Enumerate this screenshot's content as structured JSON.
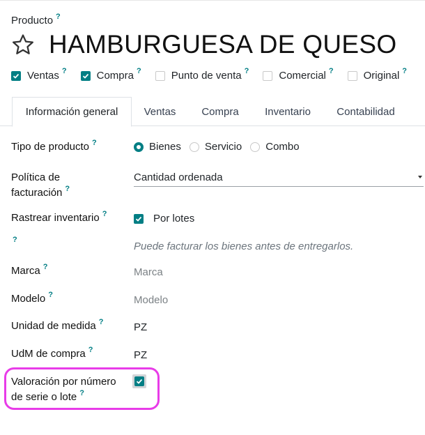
{
  "header": {
    "product_label": "Producto",
    "help_mark": "?",
    "title": "HAMBURGUESA DE QUESO"
  },
  "flags": [
    {
      "label": "Ventas",
      "checked": true
    },
    {
      "label": "Compra",
      "checked": true
    },
    {
      "label": "Punto de venta",
      "checked": false
    },
    {
      "label": "Comercial",
      "checked": false
    },
    {
      "label": "Original",
      "checked": false
    }
  ],
  "tabs": [
    {
      "label": "Información general",
      "active": true
    },
    {
      "label": "Ventas",
      "active": false
    },
    {
      "label": "Compra",
      "active": false
    },
    {
      "label": "Inventario",
      "active": false
    },
    {
      "label": "Contabilidad",
      "active": false
    }
  ],
  "form": {
    "product_type": {
      "label": "Tipo de producto",
      "options": [
        {
          "label": "Bienes",
          "selected": true
        },
        {
          "label": "Servicio",
          "selected": false
        },
        {
          "label": "Combo",
          "selected": false
        }
      ]
    },
    "invoicing_policy": {
      "label_line1": "Política de",
      "label_line2": "facturación",
      "value": "Cantidad ordenada"
    },
    "track_inventory": {
      "label": "Rastrear inventario",
      "checked": true,
      "option_label": "Por lotes"
    },
    "note": "Puede facturar los bienes antes de entregarlos.",
    "brand": {
      "label": "Marca",
      "placeholder": "Marca"
    },
    "model": {
      "label": "Modelo",
      "placeholder": "Modelo"
    },
    "uom": {
      "label": "Unidad de medida",
      "value": "PZ"
    },
    "purchase_uom": {
      "label": "UdM de compra",
      "value": "PZ"
    },
    "valuation": {
      "label_line1": "Valoración por número",
      "label_line2": "de serie o lote",
      "checked": true
    }
  },
  "colors": {
    "accent": "#017e84",
    "highlight": "#e83ce8"
  }
}
